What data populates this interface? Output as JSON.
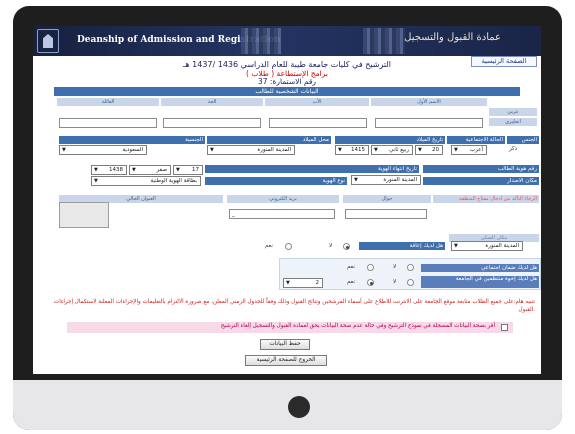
{
  "page": {
    "banner_title": "Deanship of Admission and Registration",
    "banner_arabic": "عمادة القبول والتسجيل",
    "home_link": "الصفحة الرئيسية",
    "title_line": "الترشيح في كليات جامعة طيبة للعام الدراسي 1436 /1437 هـ",
    "program_line": "برامج الإستطاعة ( طلاب )",
    "application_number_label": "رقم الاستمارة:",
    "application_number": "37"
  },
  "personal": {
    "section_title": "البيانات الشخصية للطالب",
    "name_headers": [
      "الاسم الأول",
      "الأب",
      "الجد",
      "العائلة"
    ],
    "row_labels": [
      "عربي",
      "انجليزي"
    ],
    "arabic_name": [
      "",
      "",
      "",
      ""
    ],
    "english_name": [
      "",
      "",
      "",
      ""
    ],
    "gender_label": "الجنس",
    "gender_value": "ذكر",
    "marital_label": "الحالة الاجتماعية",
    "marital_value": "أعزب",
    "birth_date_label": "تاريخ الميلاد",
    "birth_day": "20",
    "birth_month": "ربيع ثاني",
    "birth_year": "1415",
    "birth_place_label": "محل الميلاد",
    "birth_place_value": "المدينة المنورة",
    "nationality_label": "الجنسية",
    "nationality_value": "السعودية"
  },
  "identity": {
    "id_number_label": "رقم هوية الطالب",
    "id_expiry_label": "تاريخ انتهاء الهوية",
    "expiry_day": "17",
    "expiry_month": "صفر",
    "expiry_year": "1438",
    "issue_place_label": "مكان الاصدار",
    "issue_place_value": "المدينة المنورة",
    "id_type_label": "نوع الهوية",
    "id_type_value": "بطاقة الهوية الوطنية"
  },
  "contact": {
    "area_code_label": "مفتاح المنطقة",
    "area_code_hint": "الرجاء التأكد من ادخال",
    "mobile_label": "جوال",
    "email_label": "بريد الكتروني",
    "address_label": "العنوان الحالي",
    "email_placeholder": "_"
  },
  "residence": {
    "city_label": "مكان السكن",
    "city_value": "المدينة المنورة",
    "disability_label": "هل لديك إعاقة",
    "disability_no": "لا",
    "disability_yes": "نعم"
  },
  "questions": {
    "social_security_label": "هل لديك ضمان اجتماعي",
    "social_no": "لا",
    "social_yes": "نعم",
    "siblings_label": "هل لديك إخوة منتظمين في الجامعة",
    "siblings_no": "لا",
    "siblings_yes": "نعم",
    "siblings_count": "2"
  },
  "footer": {
    "note": "تنبيه هام:على جميع الطلاب متابعة موقع الجامعة على الانترنت للاطلاع على أسماء المرشحين ونتائج القبول وذلك وفقاً للجدول الزمني المعلن، مع ضرورة الالتزام بالتعليمات والإجراءات المعلنة لاستكمال إجراءات القبول.",
    "agreement": "أقر بصحة البيانات المسجلة في نموذج الترشيح وفي حالة عدم صحة البيانات يحق لعمادة القبول والتسجيل إلغاء الترشيح",
    "save_button": "حفظ البيانات",
    "exit_button": "الخروج للصفحة الرئيسية"
  }
}
